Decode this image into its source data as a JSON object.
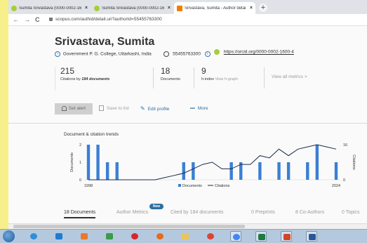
{
  "browser": {
    "tabs": [
      {
        "label": "Sumita Srivastava (0000-0002-16",
        "active": false,
        "favicon_color": "#a6ce39"
      },
      {
        "label": "Sumita Srivastava (0000-0002-16",
        "active": false,
        "favicon_color": "#a6ce39"
      },
      {
        "label": "Srivastava, Sumita - Author detai",
        "active": true,
        "favicon_color": "#f07d00"
      }
    ],
    "tab_close": "×",
    "new_tab": "+",
    "back": "←",
    "forward": "→",
    "reload": "C",
    "url": "scopus.com/authid/detail.uri?authorId=55455763300"
  },
  "profile": {
    "name": "Srivastava, Sumita",
    "affiliation": "Government P. G. College, Uttarkashi, India",
    "scopus_id": "55455763300",
    "orcid": "https://orcid.org/0000-0002-1600-4"
  },
  "metrics": [
    {
      "value": "215",
      "label_prefix": "Citations by",
      "label_emph": "184 documents"
    },
    {
      "value": "18",
      "label": "Documents"
    },
    {
      "value": "9",
      "label": "h-index",
      "label_link": "View h-graph"
    }
  ],
  "view_all": "View all metrics >",
  "actions": {
    "set_alert": "Set alert",
    "save_to_list": "Save to list",
    "edit_profile": "Edit profile",
    "more": "More"
  },
  "chart_data": {
    "title": "Document & citation trends",
    "type": "bar+line",
    "x_start_label": "1998",
    "x_end_label": "2024",
    "ylabel_left": "Documents",
    "ylabel_right": "Citations",
    "left_ticks": [
      "2",
      "1",
      "0"
    ],
    "right_ticks": [
      "16",
      "0"
    ],
    "ylim_left": [
      0,
      2
    ],
    "ylim_right": [
      0,
      16
    ],
    "years": [
      1998,
      1999,
      2000,
      2001,
      2002,
      2003,
      2004,
      2005,
      2006,
      2007,
      2008,
      2009,
      2010,
      2011,
      2012,
      2013,
      2014,
      2015,
      2016,
      2017,
      2018,
      2019,
      2020,
      2021,
      2022,
      2023,
      2024
    ],
    "series": [
      {
        "name": "Documents",
        "color": "#3a7fd5",
        "values": [
          2,
          2,
          1,
          1,
          0,
          0,
          0,
          0,
          0,
          0,
          1,
          1,
          0,
          0,
          0,
          1,
          1,
          0,
          1,
          0,
          1,
          1,
          0,
          1,
          2,
          0,
          1
        ]
      },
      {
        "name": "Citations",
        "color": "#1a2b4a",
        "values": [
          0,
          0,
          0,
          0,
          0,
          0,
          0,
          0,
          1,
          2,
          3,
          5,
          7,
          8,
          5,
          5,
          7,
          7,
          11,
          10,
          14,
          11,
          14,
          15,
          16,
          15,
          14
        ]
      }
    ],
    "legend_position": "bottom"
  },
  "bottom_tabs": [
    {
      "label": "18 Documents",
      "active": true
    },
    {
      "label": "Author Metrics",
      "active": false
    },
    {
      "label": "Cited by 184 documents",
      "active": false
    },
    {
      "label": "0 Preprints",
      "active": false
    },
    {
      "label": "8 Co-Authors",
      "active": false
    },
    {
      "label": "0 Topics",
      "active": false
    }
  ],
  "new_badge": "New",
  "taskbar": {
    "icons": [
      {
        "name": "ie-icon",
        "color": "#2f8ed6"
      },
      {
        "name": "explorer-icon",
        "color": "#1e7ccf"
      },
      {
        "name": "media-icon",
        "color": "#e8792f"
      },
      {
        "name": "photos-icon",
        "color": "#3c9a4a"
      },
      {
        "name": "opera-icon",
        "color": "#d6262f"
      },
      {
        "name": "firefox-icon",
        "color": "#e66a1d"
      },
      {
        "name": "folder-icon",
        "color": "#e8c45a"
      },
      {
        "name": "chrome-icon",
        "color": "#db4437"
      },
      {
        "name": "chrome-icon-2",
        "color": "#4285f4"
      },
      {
        "name": "excel-icon",
        "color": "#1f7a3f"
      },
      {
        "name": "powerpoint-icon",
        "color": "#d24726"
      },
      {
        "name": "word-icon",
        "color": "#2b579a"
      }
    ]
  }
}
